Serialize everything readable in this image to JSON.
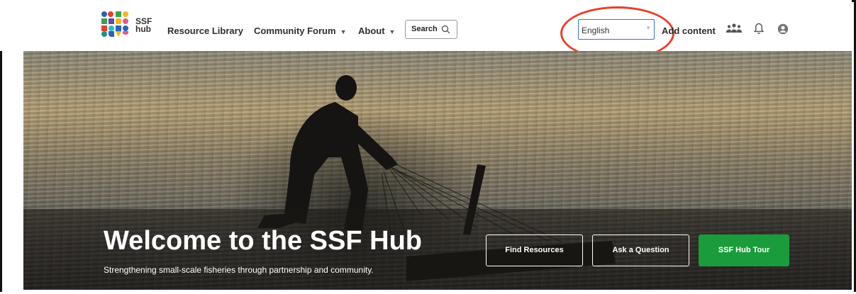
{
  "brand": {
    "line1": "SSF",
    "line2": "hub"
  },
  "nav": {
    "resource_library": "Resource Library",
    "community_forum": "Community Forum",
    "about": "About",
    "search": "Search"
  },
  "language": {
    "selected": "English"
  },
  "actions": {
    "add_content": "Add content"
  },
  "hero": {
    "title": "Welcome to the SSF Hub",
    "subtitle": "Strengthening small-scale fisheries through partnership and community.",
    "buttons": {
      "find": "Find Resources",
      "ask": "Ask a Question",
      "tour": "SSF Hub Tour"
    }
  },
  "colors": {
    "accent_green": "#1a9c3c",
    "annotation_red": "#e8402a",
    "focus_blue": "#3b73c7"
  },
  "icons": [
    "logo-icon",
    "chevron-down-icon",
    "search-icon",
    "people-icon",
    "bell-icon",
    "user-icon"
  ]
}
